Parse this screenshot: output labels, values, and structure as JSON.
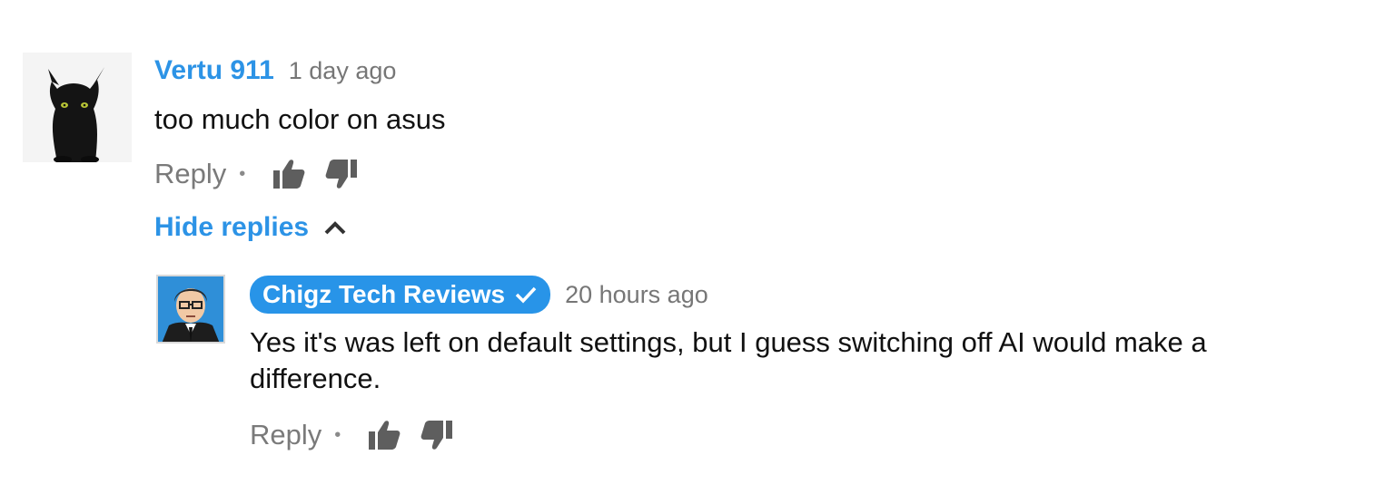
{
  "comment": {
    "author": "Vertu 911",
    "time": "1 day ago",
    "text": "too much color on asus",
    "reply_label": "Reply",
    "separator": "•",
    "avatar_icon": "dragon-avatar"
  },
  "hide_replies": {
    "label": "Hide replies",
    "icon": "chevron-up-icon"
  },
  "reply": {
    "author": "Chigz Tech Reviews",
    "verified_icon": "checkmark-icon",
    "time": "20 hours ago",
    "text": "Yes it's was left on default settings, but I guess switching off AI would make a difference.",
    "reply_label": "Reply",
    "separator": "•",
    "avatar_icon": "cartoon-man-avatar"
  },
  "colors": {
    "link_blue": "#2c93e6",
    "badge_blue": "#2894e8",
    "muted_gray": "#7a7a7a",
    "icon_gray": "#5e5e5e"
  }
}
